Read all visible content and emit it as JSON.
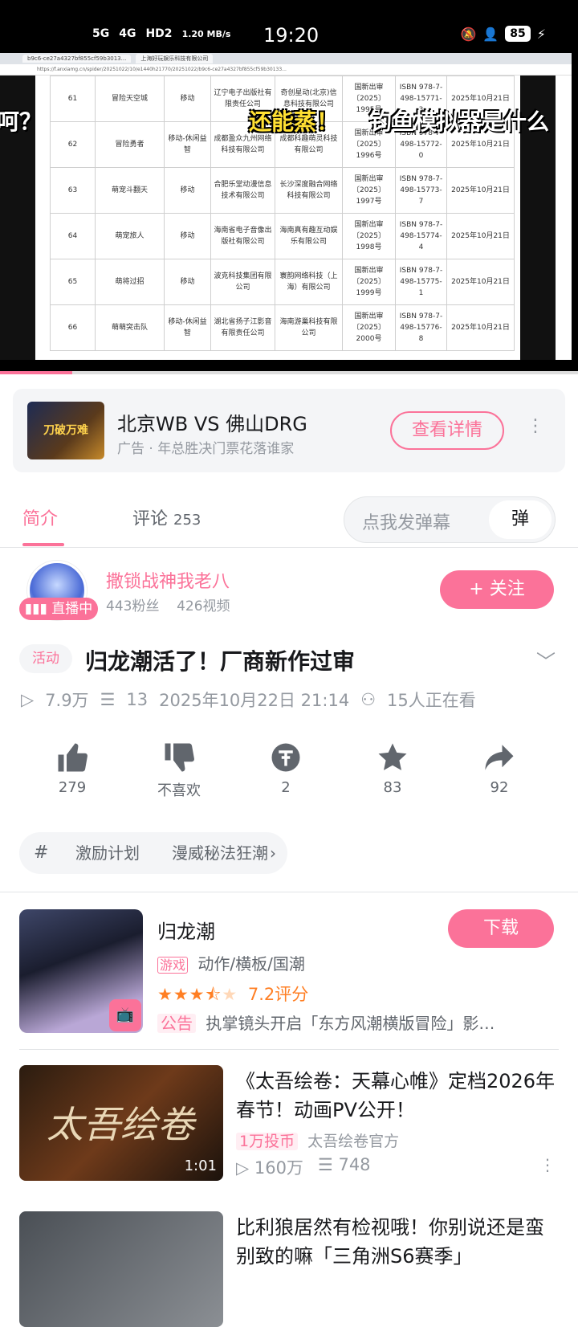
{
  "status_bar": {
    "network": [
      "5G",
      "4G",
      "HD2",
      "1.20 MB/s"
    ],
    "time": "19:20",
    "battery": "85"
  },
  "video_player": {
    "captions": {
      "left": "呵？",
      "yellow": "还能蒸！",
      "white": "钓鱼模拟器是什么"
    },
    "browser_tabs": [
      "b9c6-ce27a4327bf855cf59b3013...",
      "上海好玩娱乐科技有限公司"
    ],
    "browser_url": "https://f.anxiamg.cn/spider/20251022/10/e1440h21770/20251022/b9c6-ce27a4327bf855cf59b30133...",
    "table_rows": [
      {
        "no": "61",
        "name": "冒险天空城",
        "type": "移动",
        "publisher": "辽宁电子出版社有限责任公司",
        "operator": "奇创星动(北京)信息科技有限公司",
        "approval": "国新出审〔2025〕1995号",
        "isbn": "ISBN 978-7-498-15771-3",
        "date": "2025年10月21日"
      },
      {
        "no": "62",
        "name": "冒险勇者",
        "type": "移动-休闲益智",
        "publisher": "成都盈众九州网络科技有限公司",
        "operator": "成都科趣萌灵科技有限公司",
        "approval": "国新出审〔2025〕1996号",
        "isbn": "ISBN 978-7-498-15772-0",
        "date": "2025年10月21日"
      },
      {
        "no": "63",
        "name": "萌宠斗翻天",
        "type": "移动",
        "publisher": "合肥乐堂动漫信息技术有限公司",
        "operator": "长沙深度融合网络科技有限公司",
        "approval": "国新出审〔2025〕1997号",
        "isbn": "ISBN 978-7-498-15773-7",
        "date": "2025年10月21日"
      },
      {
        "no": "64",
        "name": "萌宠旅人",
        "type": "移动",
        "publisher": "海南省电子音像出版社有限公司",
        "operator": "海南真有趣互动娱乐有限公司",
        "approval": "国新出审〔2025〕1998号",
        "isbn": "ISBN 978-7-498-15774-4",
        "date": "2025年10月21日"
      },
      {
        "no": "65",
        "name": "萌将过招",
        "type": "移动",
        "publisher": "波克科技集团有限公司",
        "operator": "寰韵网络科技（上海）有限公司",
        "approval": "国新出审〔2025〕1999号",
        "isbn": "ISBN 978-7-498-15775-1",
        "date": "2025年10月21日"
      },
      {
        "no": "66",
        "name": "萌萌突击队",
        "type": "移动-休闲益智",
        "publisher": "湖北省扬子江影音有限责任公司",
        "operator": "海南游巢科技有限公司",
        "approval": "国新出审〔2025〕2000号",
        "isbn": "ISBN 978-7-498-15776-8",
        "date": "2025年10月21日"
      }
    ],
    "progress": 0.125
  },
  "ad": {
    "thumb_text": "刀破万难",
    "title": "北京WB VS 佛山DRG",
    "subtitle": "广告 · 年总胜决门票花落谁家",
    "button": "查看详情",
    "more": "⋮"
  },
  "tabs": {
    "intro": "简介",
    "comments": "评论",
    "comments_count": "253",
    "danmaku_placeholder": "点我发弹幕",
    "danmaku_icon": "弹"
  },
  "author": {
    "name": "撒锁战神我老八",
    "fans": "443粉丝",
    "videos": "426视频",
    "live_badge": "直播中",
    "follow": "+ 关注"
  },
  "video_info": {
    "tag": "活动",
    "title": "归龙潮活了！厂商新作过审",
    "views": "7.9万",
    "danmaku": "13",
    "datetime": "2025年10月22日 21:14",
    "watching": "15人正在看"
  },
  "actions": {
    "like": "279",
    "dislike": "不喜欢",
    "coin": "2",
    "favorite": "83",
    "share": "92"
  },
  "incentive": {
    "text1": "激励计划",
    "text2": "漫威秘法狂潮"
  },
  "game": {
    "name": "归龙潮",
    "tag": "游戏",
    "genres": "动作/横板/国潮",
    "rating": "7.2评分",
    "stars": 3.5,
    "notice_tag": "公告",
    "notice": "执掌镜头开启「东方风潮横版冒险」影…",
    "download": "下载"
  },
  "recommendations": [
    {
      "thumb_text": "太吾绘卷",
      "duration": "1:01",
      "title": "《太吾绘卷：天幕心帷》定档2026年春节！动画PV公开！",
      "badge": "1万投币",
      "uploader": "太吾绘卷官方",
      "views": "160万",
      "danmaku": "748"
    },
    {
      "title": "比利狼居然有检视哦！你别说还是蛮别致的嘛「三角洲S6赛季」"
    }
  ]
}
